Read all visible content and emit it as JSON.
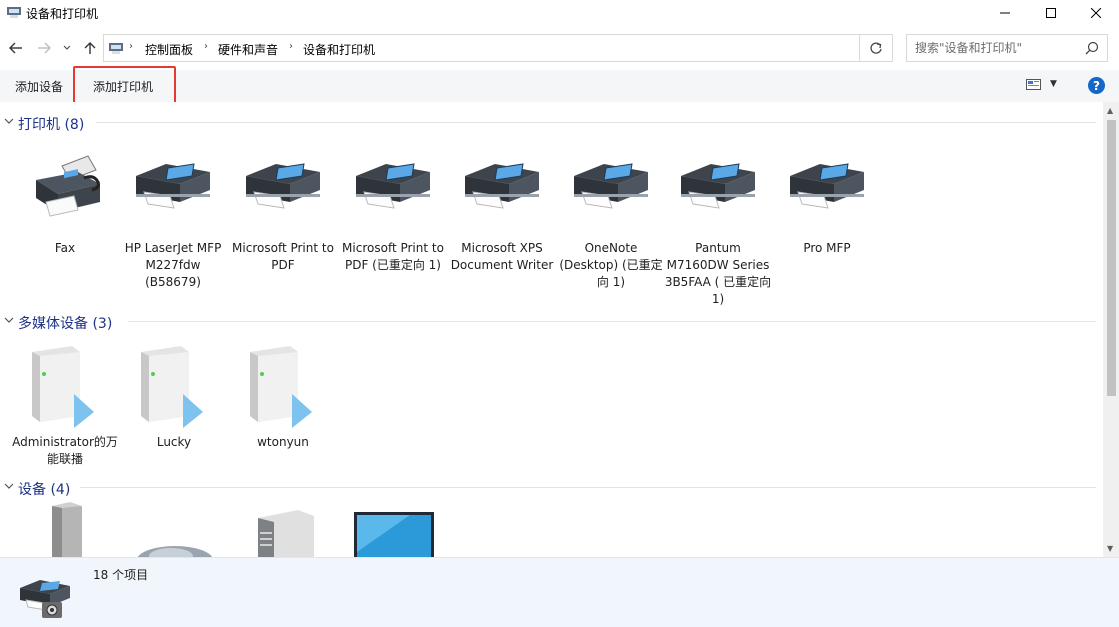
{
  "window": {
    "title": "设备和打印机"
  },
  "nav": {
    "breadcrumbs": [
      "控制面板",
      "硬件和声音",
      "设备和打印机"
    ],
    "search_placeholder": "搜索\"设备和打印机\""
  },
  "toolbar": {
    "add_device": "添加设备",
    "add_printer": "添加打印机"
  },
  "groups": {
    "printers": {
      "title": "打印机 (8)",
      "items": [
        {
          "label": "Fax",
          "icon": "fax-icon"
        },
        {
          "label": "HP LaserJet MFP M227fdw (B58679)",
          "icon": "printer-icon"
        },
        {
          "label": "Microsoft Print to PDF",
          "icon": "printer-icon"
        },
        {
          "label": "Microsoft Print to PDF (已重定向 1)",
          "icon": "printer-icon"
        },
        {
          "label": "Microsoft XPS Document Writer",
          "icon": "printer-icon"
        },
        {
          "label": "OneNote (Desktop) (已重定向 1)",
          "icon": "printer-icon"
        },
        {
          "label": "Pantum M7160DW Series 3B5FAA ( 已重定向 1)",
          "icon": "printer-icon"
        },
        {
          "label": "Pro MFP",
          "icon": "printer-icon"
        }
      ]
    },
    "media": {
      "title": "多媒体设备 (3)",
      "items": [
        {
          "label": "Administrator的万能联播",
          "icon": "media-server-icon"
        },
        {
          "label": "Lucky",
          "icon": "media-server-icon"
        },
        {
          "label": "wtonyun",
          "icon": "media-server-icon"
        }
      ]
    },
    "devices": {
      "title": "设备 (4)",
      "items": [
        {
          "icon": "speaker-tower-icon"
        },
        {
          "icon": "mouse-icon"
        },
        {
          "icon": "computer-tower-icon"
        },
        {
          "icon": "monitor-icon"
        }
      ]
    }
  },
  "status": {
    "item_count": "18 个项目"
  },
  "colors": {
    "group_title": "#1e3287",
    "highlight": "#e53935",
    "help": "#1468c9"
  }
}
